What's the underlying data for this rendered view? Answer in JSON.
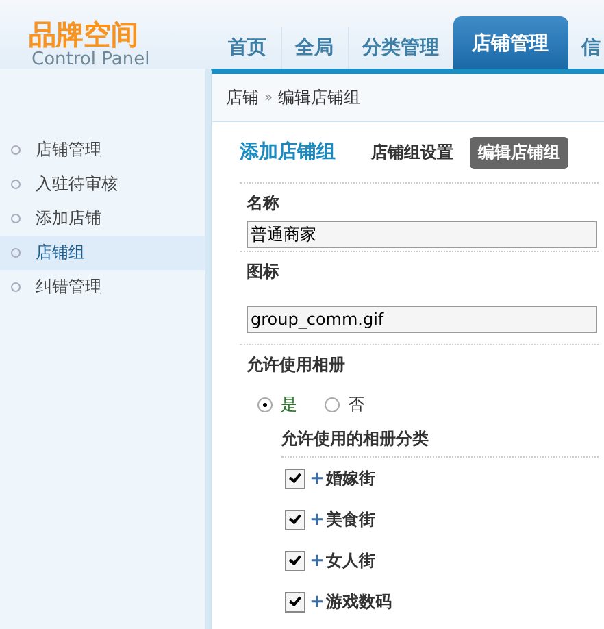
{
  "logo": {
    "title": "品牌空间",
    "subtitle": "Control Panel"
  },
  "nav_tabs": [
    {
      "label": "首页",
      "selected": false
    },
    {
      "label": "全局",
      "selected": false
    },
    {
      "label": "分类管理",
      "selected": false
    },
    {
      "label": "店铺管理",
      "selected": true
    },
    {
      "label": "信",
      "selected": false
    }
  ],
  "breadcrumb": [
    "店铺",
    "»",
    "编辑店铺组"
  ],
  "sidebar": {
    "items": [
      {
        "label": "店铺管理",
        "selected": false
      },
      {
        "label": "入驻待审核",
        "selected": false
      },
      {
        "label": "添加店铺",
        "selected": false
      },
      {
        "label": "店铺组",
        "selected": true
      },
      {
        "label": "纠错管理",
        "selected": false
      }
    ]
  },
  "panel": {
    "title": "添加店铺组",
    "tabs": [
      {
        "label": "店铺组设置",
        "selected": false
      },
      {
        "label": "编辑店铺组",
        "selected": true
      }
    ]
  },
  "form": {
    "name": {
      "label": "名称",
      "value": "普通商家"
    },
    "icon": {
      "label": "图标",
      "value": "group_comm.gif"
    },
    "album": {
      "label": "允许使用相册",
      "options": [
        {
          "label": "是",
          "selected": true
        },
        {
          "label": "否",
          "selected": false
        }
      ]
    },
    "categories": {
      "label": "允许使用的相册分类",
      "items": [
        {
          "expander": "+",
          "label": "婚嫁街",
          "checked": true
        },
        {
          "expander": "+",
          "label": "美食街",
          "checked": true
        },
        {
          "expander": "+",
          "label": "女人街",
          "checked": true
        },
        {
          "expander": "+",
          "label": "游戏数码",
          "checked": true
        }
      ]
    }
  }
}
